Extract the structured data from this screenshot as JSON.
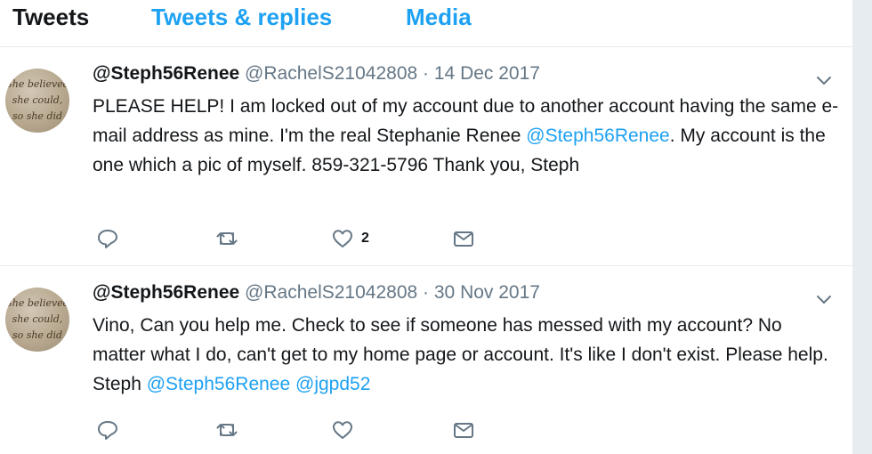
{
  "tabs": [
    {
      "label": "Tweets",
      "active": true
    },
    {
      "label": "Tweets & replies",
      "active": false
    },
    {
      "label": "Media",
      "active": false
    }
  ],
  "avatar_text": [
    "She believed",
    "she could,",
    "so she did"
  ],
  "tweets": [
    {
      "name": "@Steph56Renee",
      "handle": "@RachelS21042808",
      "separator": "·",
      "date": "14 Dec 2017",
      "text": [
        {
          "t": "PLEASE HELP! I am locked out of my account due to another account having the same e-mail address as mine. I'm the real Stephanie Renee "
        },
        {
          "t": "@Steph56Renee",
          "mention": true
        },
        {
          "t": ". My account is the one which a pic of myself. 859-321-5796 Thank you, Steph"
        }
      ],
      "like_count": "2"
    },
    {
      "name": "@Steph56Renee",
      "handle": "@RachelS21042808",
      "separator": "·",
      "date": "30 Nov 2017",
      "text": [
        {
          "t": "Vino, Can you help me. Check to see if someone has messed with my account? No matter what I do, can't get to my home page or account. It's like I don't exist. Please help. Steph "
        },
        {
          "t": "@Steph56Renee",
          "mention": true
        },
        {
          "t": " "
        },
        {
          "t": "@jgpd52",
          "mention": true
        }
      ],
      "like_count": ""
    }
  ],
  "icons": [
    "reply-icon",
    "retweet-icon",
    "like-icon",
    "message-icon",
    "chevron-down-icon"
  ],
  "colors": {
    "link": "#1da1f2",
    "text": "#14171a",
    "secondary": "#657786",
    "divider": "#e6ecf0",
    "icon": "#657786"
  }
}
